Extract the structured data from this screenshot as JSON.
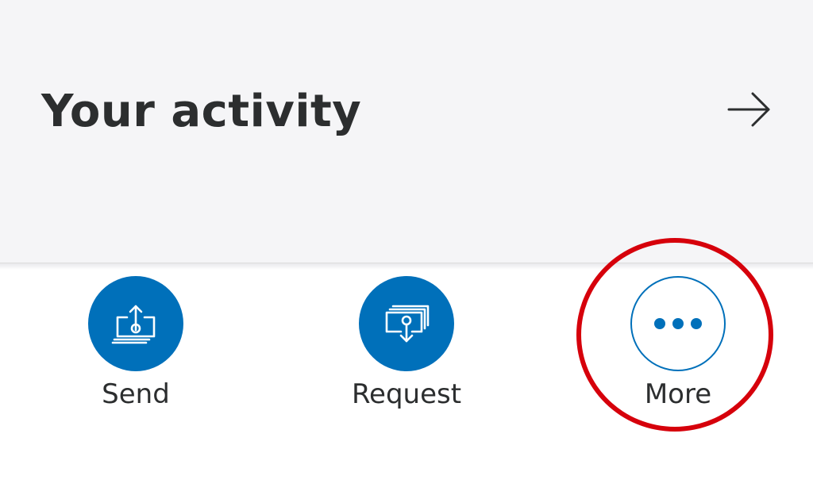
{
  "activity": {
    "title": "Your activity",
    "arrow_icon": "arrow-right-icon"
  },
  "actions": [
    {
      "label": "Send",
      "icon": "send-money-icon"
    },
    {
      "label": "Request",
      "icon": "request-money-icon"
    },
    {
      "label": "More",
      "icon": "more-dots-icon"
    }
  ],
  "colors": {
    "accent": "#0070ba",
    "card_background": "#f5f5f7",
    "text": "#2c2e2f",
    "highlight": "#d6000b"
  }
}
